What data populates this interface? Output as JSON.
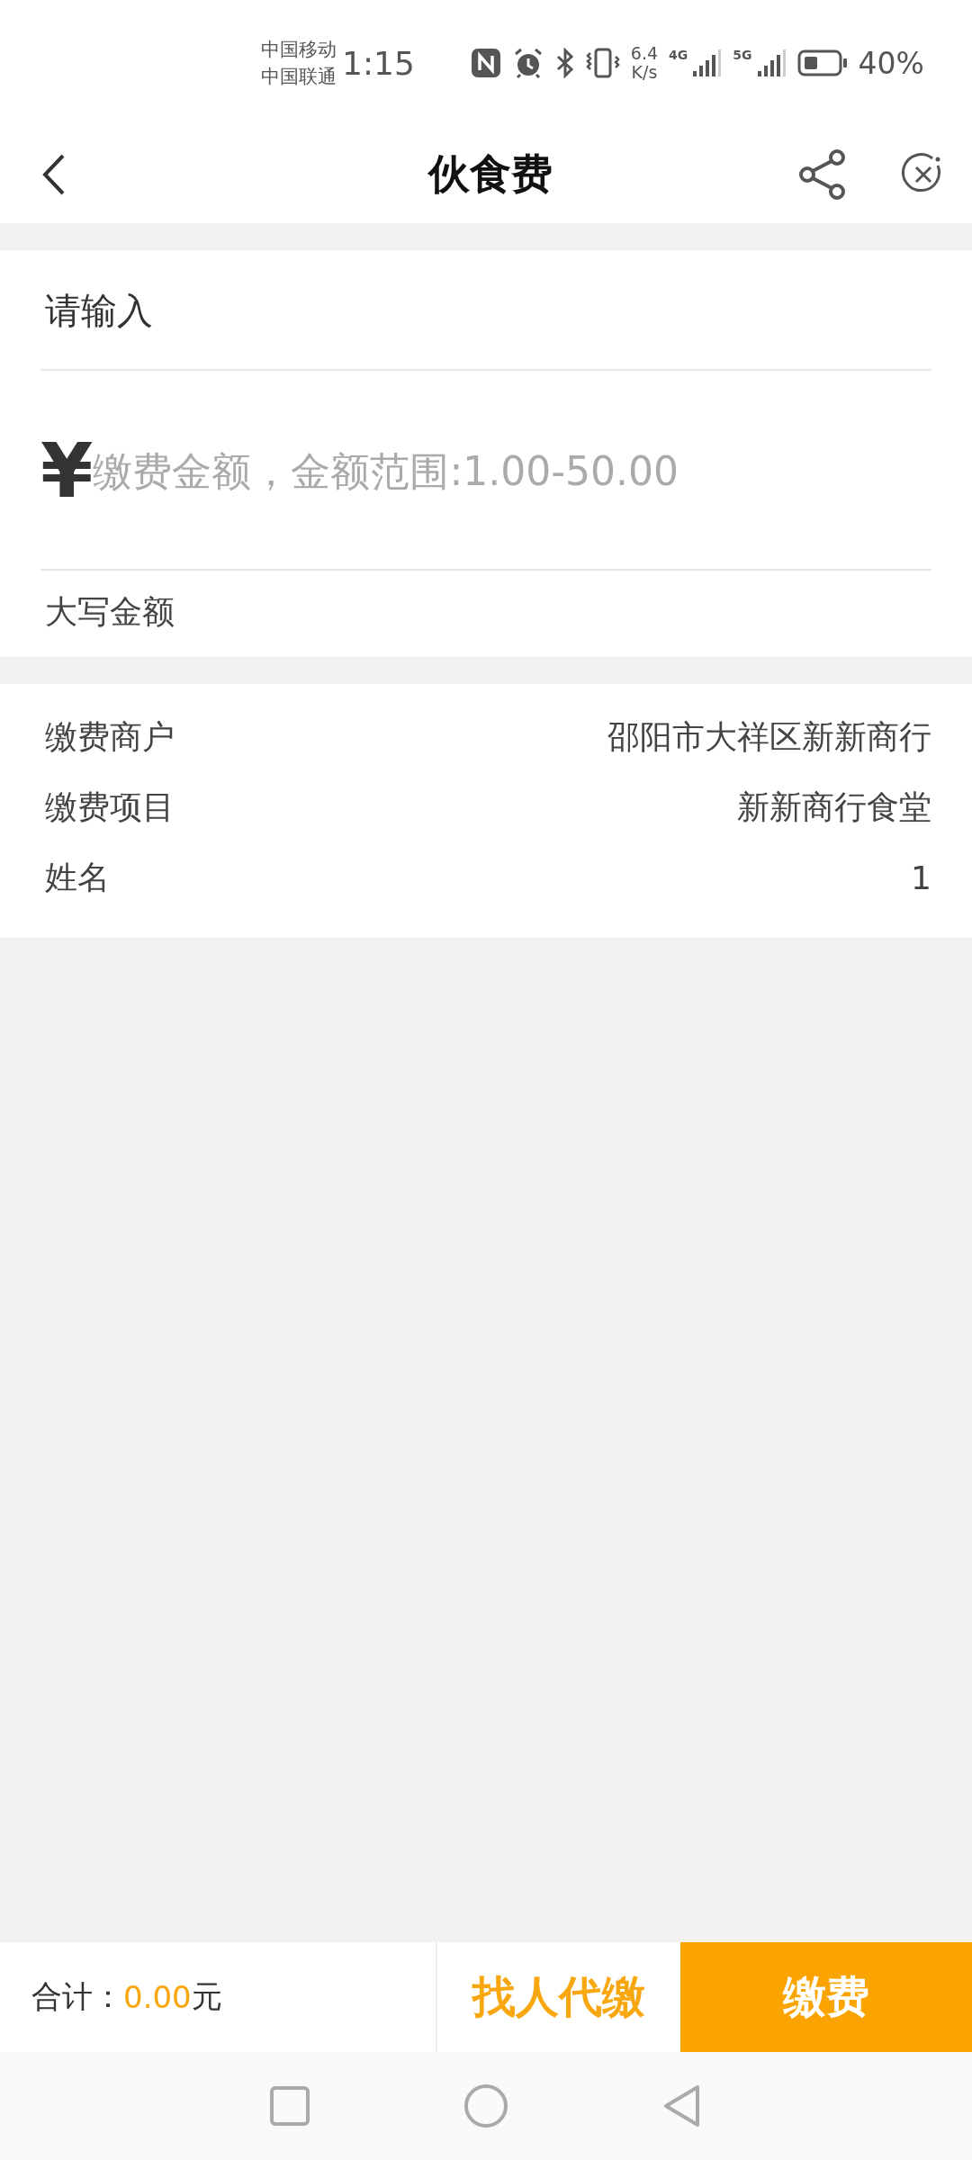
{
  "status_bar": {
    "carriers": [
      "中国移动",
      "中国联通"
    ],
    "time": "1:15",
    "speed": "6.4",
    "speed_unit": "K/s",
    "networks": [
      "4G",
      "5G"
    ],
    "battery": "40%"
  },
  "header": {
    "title": "伙食费"
  },
  "form": {
    "name_field": {
      "placeholder": "请输入"
    },
    "currency": "¥",
    "amount_field": {
      "placeholder": "缴费金额，金额范围:1.00-50.00"
    },
    "uppercase_label": "大写金额"
  },
  "details": [
    {
      "label": "缴费商户",
      "value": "邵阳市大祥区新新商行"
    },
    {
      "label": "缴费项目",
      "value": "新新商行食堂"
    },
    {
      "label": "姓名",
      "value": "1"
    }
  ],
  "footer": {
    "total_label": "合计：",
    "total_amount": "0.00",
    "total_unit": "元",
    "proxy_button": "找人代缴",
    "pay_button": "缴费"
  }
}
